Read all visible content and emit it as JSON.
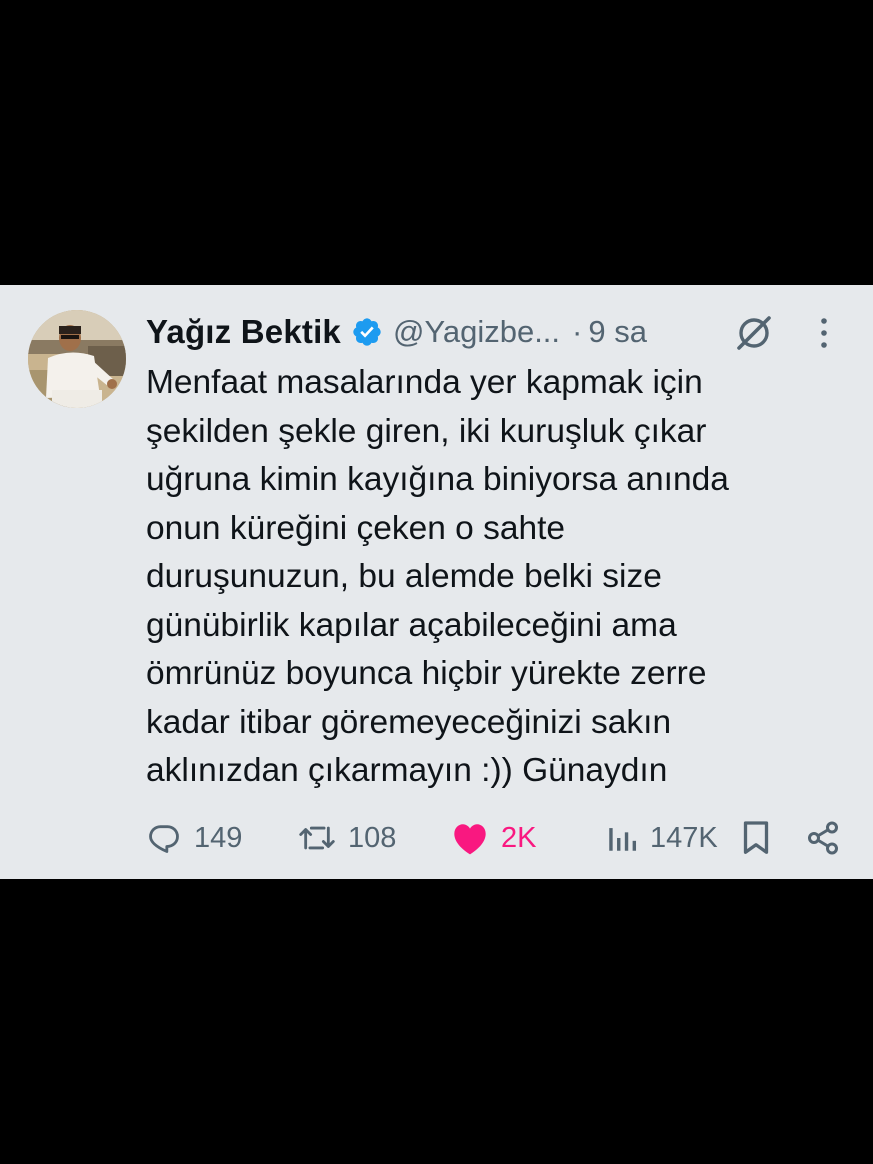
{
  "tweet": {
    "author_name": "Yağız Bektik",
    "handle": "@Yagizbe...",
    "separator": "·",
    "time": "9 sa",
    "text_lines": [
      "Menfaat masalarında yer kapmak için",
      "şekilden şekle giren, iki kuruşluk çıkar",
      "uğruna kimin kayığına biniyorsa anında",
      "onun küreğini çeken o sahte",
      "duruşunuzun, bu alemde belki size",
      "günübirlik kapılar açabileceğini ama",
      "ömrünüz boyunca hiçbir yürekte zerre",
      "kadar itibar göremeyeceğinizi sakın",
      "aklınızdan çıkarmayın :)) Günaydın"
    ]
  },
  "actions": {
    "replies": "149",
    "retweets": "108",
    "likes": "2K",
    "views": "147K"
  },
  "icons": {
    "verified": "verified-badge-icon",
    "grok": "grok-icon",
    "more": "more-vertical-icon",
    "reply": "reply-icon",
    "retweet": "retweet-icon",
    "like": "heart-icon",
    "views": "views-icon",
    "bookmark": "bookmark-icon",
    "share": "share-icon"
  },
  "colors": {
    "background": "#e6e9ec",
    "text": "#0f1419",
    "muted": "#536471",
    "verified": "#1d9bf0",
    "like": "#f91880"
  }
}
